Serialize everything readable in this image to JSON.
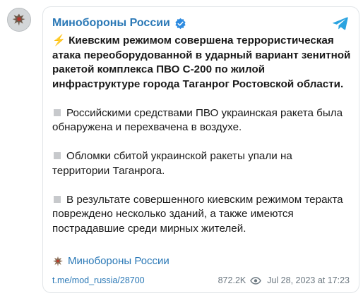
{
  "channel": {
    "name": "Минобороны России",
    "verified": true,
    "accent_color": "#2a78b6",
    "platform_icon": "telegram-icon"
  },
  "post": {
    "lead_icon": "⚡",
    "lead": "Киевским режимом совершена террористическая атака переоборудованной в ударный вариант зенитной ракетой комплекса ПВО С-200 по жилой инфраструктуре города Таганрог Ростовской области.",
    "paragraphs": [
      "Российскими средствами ПВО украинская ракета была обнаружена и перехвачена в воздухе.",
      "Обломки сбитой украинской ракеты упали на территории Таганрога.",
      "В результате совершенного киевским режимом теракта повреждено несколько зданий, а также имеются пострадавшие среди мирных жителей."
    ]
  },
  "footer": {
    "channel_name": "Минобороны России",
    "link": "t.me/mod_russia/28700",
    "views": "872.2K",
    "timestamp": "Jul 28, 2023 at 17:23"
  }
}
